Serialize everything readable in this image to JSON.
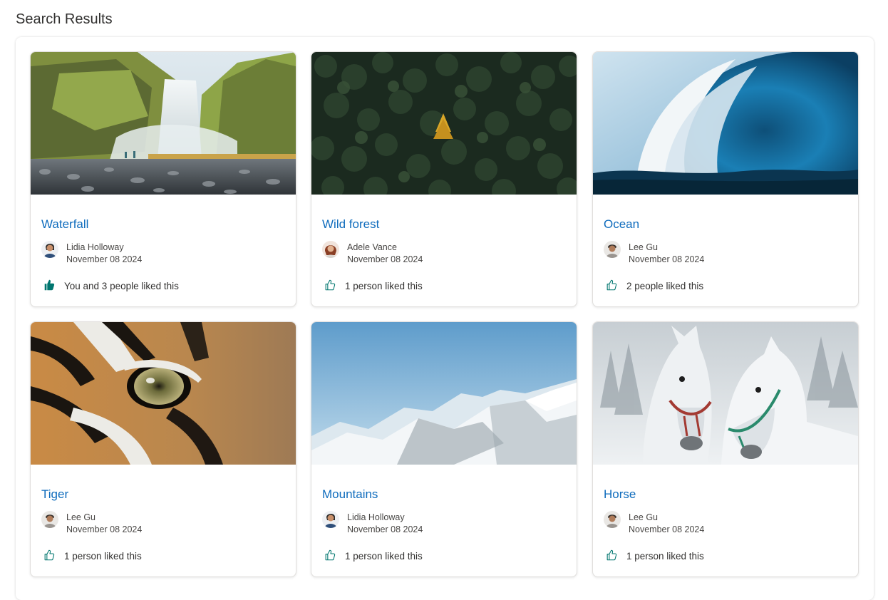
{
  "page": {
    "title": "Search Results"
  },
  "colors": {
    "title_link": "#0f6cbd",
    "like_filled": "#00766f",
    "like_outline": "#00766f"
  },
  "cards": [
    {
      "title": "Waterfall",
      "author": "Lidia Holloway",
      "date": "November 08 2024",
      "likes_text": "You and 3 people liked this",
      "liked_by_me": true,
      "image": "waterfall"
    },
    {
      "title": "Wild forest",
      "author": "Adele Vance",
      "date": "November 08 2024",
      "likes_text": "1 person liked this",
      "liked_by_me": false,
      "image": "forest"
    },
    {
      "title": "Ocean",
      "author": "Lee Gu",
      "date": "November 08 2024",
      "likes_text": "2 people liked this",
      "liked_by_me": false,
      "image": "ocean"
    },
    {
      "title": "Tiger",
      "author": "Lee Gu",
      "date": "November 08 2024",
      "likes_text": "1 person liked this",
      "liked_by_me": false,
      "image": "tiger"
    },
    {
      "title": "Mountains",
      "author": "Lidia Holloway",
      "date": "November 08 2024",
      "likes_text": "1 person liked this",
      "liked_by_me": false,
      "image": "mountains"
    },
    {
      "title": "Horse",
      "author": "Lee Gu",
      "date": "November 08 2024",
      "likes_text": "1 person liked this",
      "liked_by_me": false,
      "image": "horse"
    }
  ]
}
